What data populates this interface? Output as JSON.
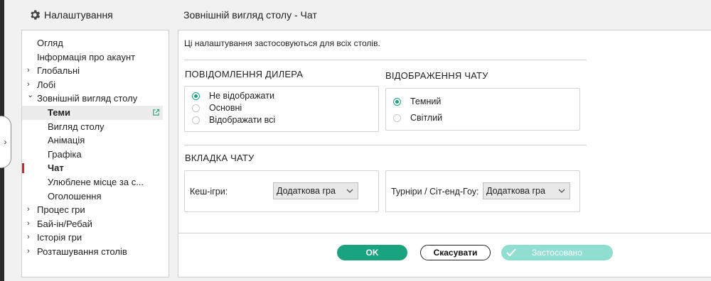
{
  "header": {
    "title": "Налаштування",
    "section_title": "Зовнішній вигляд столу - Чат"
  },
  "sidebar": {
    "items": [
      {
        "label": "Огляд",
        "chevron": ""
      },
      {
        "label": "Інформація про акаунт",
        "chevron": ""
      },
      {
        "label": "Глобальні",
        "chevron": "›"
      },
      {
        "label": "Лобі",
        "chevron": "›"
      },
      {
        "label": "Зовнішній вигляд столу",
        "chevron": "⌄"
      },
      {
        "label": "Теми",
        "chevron": ""
      },
      {
        "label": "Вигляд столу",
        "chevron": ""
      },
      {
        "label": "Анімація",
        "chevron": ""
      },
      {
        "label": "Графіка",
        "chevron": ""
      },
      {
        "label": "Чат",
        "chevron": ""
      },
      {
        "label": "Улюблене місце за с...",
        "chevron": ""
      },
      {
        "label": "Оголошення",
        "chevron": ""
      },
      {
        "label": "Процес гри",
        "chevron": "›"
      },
      {
        "label": "Бай-ін/Ребай",
        "chevron": "›"
      },
      {
        "label": "Історія гри",
        "chevron": "›"
      },
      {
        "label": "Розташування столів",
        "chevron": "›"
      }
    ]
  },
  "content": {
    "info_text": "Ці налаштування застосовуються для всіх столів.",
    "dealer_messages": {
      "title": "ПОВІДОМЛЕННЯ ДИЛЕРА",
      "options": [
        "Не відображати",
        "Основні",
        "Відображати всі"
      ],
      "selected": "Не відображати"
    },
    "chat_display": {
      "title": "ВІДОБРАЖЕННЯ ЧАТУ",
      "options": [
        "Темний",
        "Світлий"
      ],
      "selected": "Темний"
    },
    "chat_tab": {
      "title": "ВКЛАДКА ЧАТУ",
      "cash_label": "Кеш-ігри:",
      "cash_value": "Додаткова гра",
      "tourney_label": "Турніри / Сіт-енд-Гоу:",
      "tourney_value": "Додаткова гра"
    }
  },
  "buttons": {
    "ok": "OK",
    "cancel": "Скасувати",
    "applied": "Застосовано"
  },
  "colors": {
    "accent": "#1aa37f",
    "accent_disabled": "#8fded0",
    "active_marker": "#d9232e"
  }
}
